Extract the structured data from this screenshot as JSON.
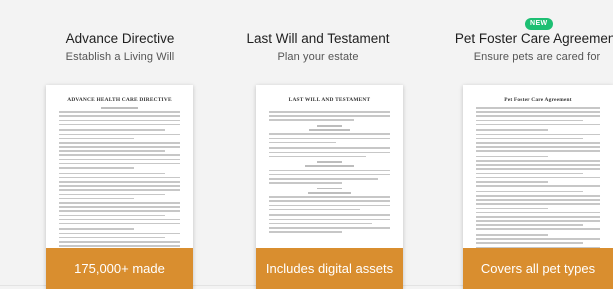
{
  "cards": [
    {
      "title": "Advance Directive",
      "subtitle": "Establish a Living Will",
      "document_title": "ADVANCE HEALTH CARE DIRECTIVE",
      "banner": "175,000+ made"
    },
    {
      "title": "Last Will and Testament",
      "subtitle": "Plan your estate",
      "document_title": "LAST WILL AND TESTAMENT",
      "banner": "Includes digital assets"
    },
    {
      "title": "Pet Foster Care Agreement",
      "subtitle": "Ensure pets are cared for",
      "badge": "NEW",
      "document_title": "Pet Foster Care Agreement",
      "banner": "Covers all pet types"
    }
  ],
  "colors": {
    "banner": "#d98e2f",
    "badge": "#1dbf73",
    "background": "#f3f3f3"
  }
}
